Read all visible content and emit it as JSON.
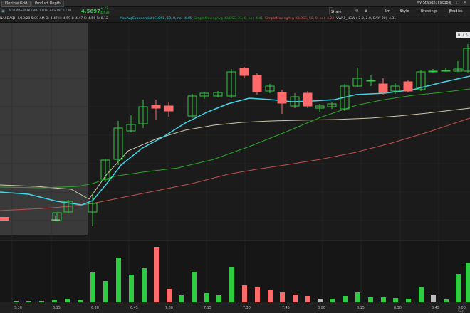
{
  "tabs": [
    "Flexible Grid",
    "Product Depth"
  ],
  "station_label": "My Station: Flexible",
  "window_controls": "_ ▢ ✕",
  "symbol": {
    "company": "ADAMAS PHARMACEUTICALS INC COM",
    "price": "4.5697",
    "change_top": "+.22",
    "change_bottom": "4.437",
    "ohlc": "D: 8/10/20 5:00 AM   O: 4.47   H: 4.59   L: 4.47   C: 4.56   R: 0.12"
  },
  "toolbar": {
    "share": "Share",
    "flask": "",
    "gear": "",
    "timeframe": "5m",
    "style": "Style",
    "drawings": "Drawings",
    "studies": "Studies"
  },
  "studies": {
    "exchange": "NASDAQ",
    "ema": "MovAvgExponential (CLOSE, 10, 0, no)",
    "ema_val": "4.45",
    "sma21": "SimpleMovingAvg (CLOSE, 21, 0, no)",
    "sma21_val": "4.41",
    "sma50": "SimpleMovingAvg (CLOSE, 50, 0, no)",
    "sma50_val": "4.22",
    "vwap": "VWAP_NEW (-2.0, 2.0, DAY, 20)",
    "vwap_val": "4.31"
  },
  "price_marker": "H: 4.5",
  "colors": {
    "up": "#2ecc40",
    "down": "#ff6b6b",
    "ema": "#3fd6e8",
    "sma21": "#2aa52a",
    "sma50": "#d0c8a8",
    "vwap": "#c05050",
    "premarket": "#3a3a3a"
  },
  "time_labels": [
    "5:30",
    "6:15",
    "6:30",
    "6:45",
    "7:00",
    "7:15",
    "7:30",
    "7:45",
    "8:00",
    "8:15",
    "8:30",
    "8:45",
    "9:00"
  ],
  "time_label_extra": "Sep"
}
